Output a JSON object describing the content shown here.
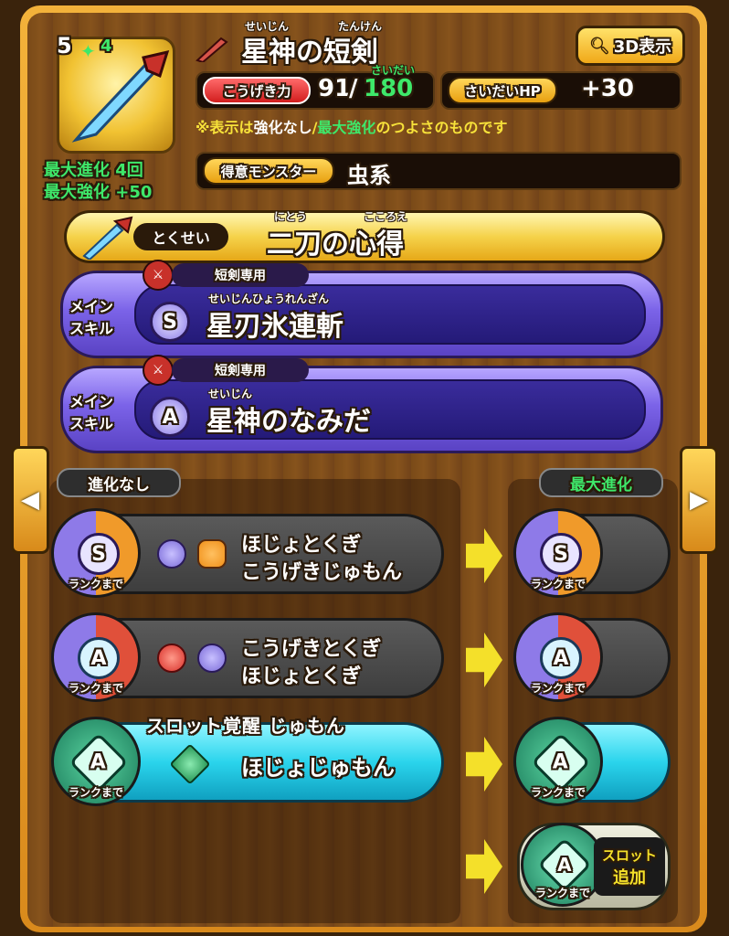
{
  "header": {
    "rarity_stars": "5",
    "plus_level": "4",
    "weapon_name": "星神の短剣",
    "weapon_name_ruby_1": "せいじん",
    "weapon_name_ruby_2": "たんけん",
    "view_3d_label": "3D表示",
    "max_evolve": "最大進化 4回",
    "max_enhance": "最大強化 +50"
  },
  "stats": {
    "attack_label": "こうげき力",
    "attack_base": "91",
    "attack_sep": "/",
    "attack_max": "180",
    "attack_max_ruby": "さいだい",
    "maxhp_label": "さいだいHP",
    "maxhp_value": "+30",
    "note_prefix": "※表示は",
    "note_a": "強化なし",
    "note_sep": "/",
    "note_b": "最大強化",
    "note_suffix": "のつよさのものです",
    "monster_label": "得意モンスター",
    "monster_value": "虫系"
  },
  "trait": {
    "label": "とくせい",
    "name": "二刀の心得",
    "ruby_1": "にとう",
    "ruby_2": "こころえ"
  },
  "skills": [
    {
      "side_label_1": "メイン",
      "side_label_2": "スキル",
      "tag": "短剣専用",
      "rank": "S",
      "name": "星刃氷連斬",
      "ruby": "せいじんひょうれんざん"
    },
    {
      "side_label_1": "メイン",
      "side_label_2": "スキル",
      "tag": "短剣専用",
      "rank": "A",
      "name": "星神のなみだ",
      "ruby": "せいじん"
    }
  ],
  "evolution": {
    "left_title": "進化なし",
    "right_title": "最大進化",
    "rank_until": "ランクまで",
    "rows": [
      {
        "rank": "S",
        "line1": "ほじょとくぎ",
        "line2": "こうげきじゅもん"
      },
      {
        "rank": "A",
        "line1": "こうげきとくぎ",
        "line2": "ほじょとくぎ"
      },
      {
        "rank": "A",
        "line1": "ほじょじゅもん",
        "line2": ""
      }
    ],
    "slot_awaken_label": "スロット覚醒 じゅもん",
    "slot_add_label_1": "スロット",
    "slot_add_label_2": "追加",
    "final_rank": "A"
  },
  "nav": {
    "prev_glyph": "◀",
    "next_glyph": "▶"
  },
  "colors": {
    "gold": "#f4c23c",
    "purple": "#6a52d8",
    "cyan": "#2ad4ec",
    "green": "#3ee86a"
  }
}
